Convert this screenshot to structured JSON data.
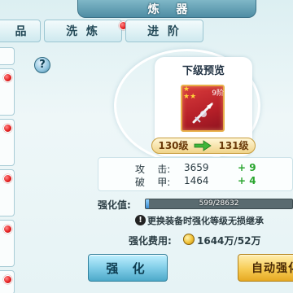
{
  "title": "炼 器",
  "tabs": [
    {
      "label": "品",
      "badge": false
    },
    {
      "label": "洗 炼",
      "badge": true
    },
    {
      "label": "进 阶",
      "badge": false
    }
  ],
  "help": {
    "label": "?"
  },
  "preview": {
    "title": "下级预览",
    "item_level_badge": "9阶",
    "from_level": "130级",
    "to_level": "131级"
  },
  "stats": [
    {
      "label": "攻    击:",
      "value": "3659",
      "increase": "+ 9"
    },
    {
      "label": "破    甲:",
      "value": "1464",
      "increase": "+ 4"
    }
  ],
  "strengthen": {
    "label": "强化值:",
    "progress_text": "599/28632",
    "progress_fraction": 0.0209
  },
  "warning": {
    "icon": "!",
    "text": "更换装备时强化等级无损继承"
  },
  "cost": {
    "label": "强化费用:",
    "value": "1644万/52万"
  },
  "buttons": {
    "strengthen": "强 化",
    "auto": "自动强化"
  },
  "colors": {
    "increase": "#29a52e",
    "badge": "#e52222",
    "gold": "#f1c237"
  }
}
